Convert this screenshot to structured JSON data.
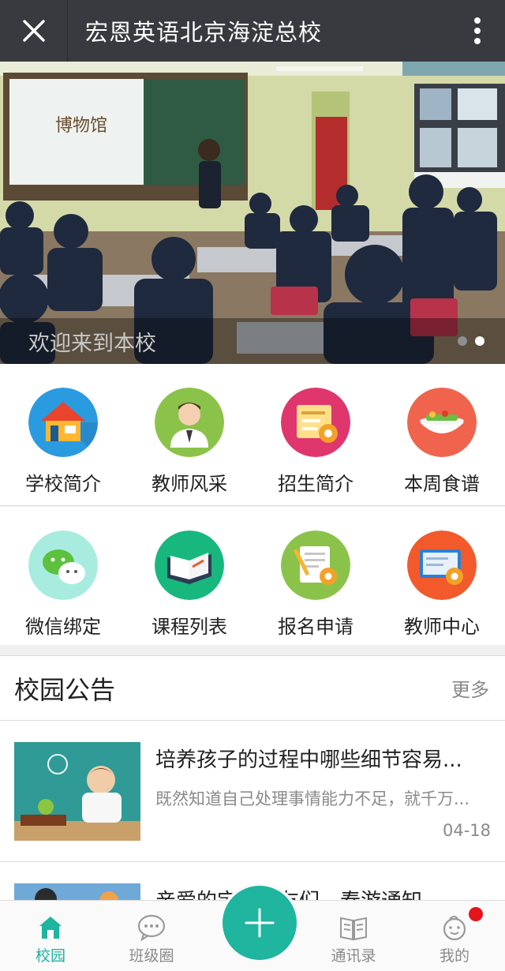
{
  "titlebar": {
    "title": "宏恩英语北京海淀总校",
    "close_icon": "close-icon",
    "more_icon": "more-vertical-icon"
  },
  "banner": {
    "caption": "欢迎来到本校",
    "board_text": "博物馆",
    "slide_count": 2,
    "active_slide": 2
  },
  "menu": {
    "row1": [
      {
        "label": "学校简介",
        "icon": "house-icon",
        "color": "#2b9be0"
      },
      {
        "label": "教师风采",
        "icon": "teacher-icon",
        "color": "#8bc34a"
      },
      {
        "label": "招生简介",
        "icon": "admission-icon",
        "color": "#e0366e"
      },
      {
        "label": "本周食谱",
        "icon": "food-plate-icon",
        "color": "#f0644d"
      }
    ],
    "row2": [
      {
        "label": "微信绑定",
        "icon": "wechat-icon",
        "color": "#a8ece0"
      },
      {
        "label": "课程列表",
        "icon": "book-icon",
        "color": "#18b77e"
      },
      {
        "label": "报名申请",
        "icon": "form-icon",
        "color": "#8bc34a"
      },
      {
        "label": "教师中心",
        "icon": "monitor-gear-icon",
        "color": "#f25a2c"
      }
    ]
  },
  "notice": {
    "title": "校园公告",
    "more": "更多",
    "articles": [
      {
        "title": "培养孩子的过程中哪些细节容易...",
        "desc": "既然知道自己处理事情能力不足，就千万...",
        "date": "04-18"
      },
      {
        "title": "亲爱的宝贝朋友们，春游通知",
        "desc": "",
        "date": ""
      }
    ]
  },
  "tabbar": {
    "tabs": [
      {
        "label": "校园",
        "icon": "home-icon",
        "active": true
      },
      {
        "label": "班级圈",
        "icon": "chat-bubble-icon",
        "active": false
      },
      {
        "label": "",
        "icon": "plus-icon",
        "active": false
      },
      {
        "label": "通讯录",
        "icon": "contacts-book-icon",
        "active": false
      },
      {
        "label": "我的",
        "icon": "profile-icon",
        "active": false
      }
    ],
    "accent": "#1fb59f",
    "badge_color": "#e4141a"
  }
}
